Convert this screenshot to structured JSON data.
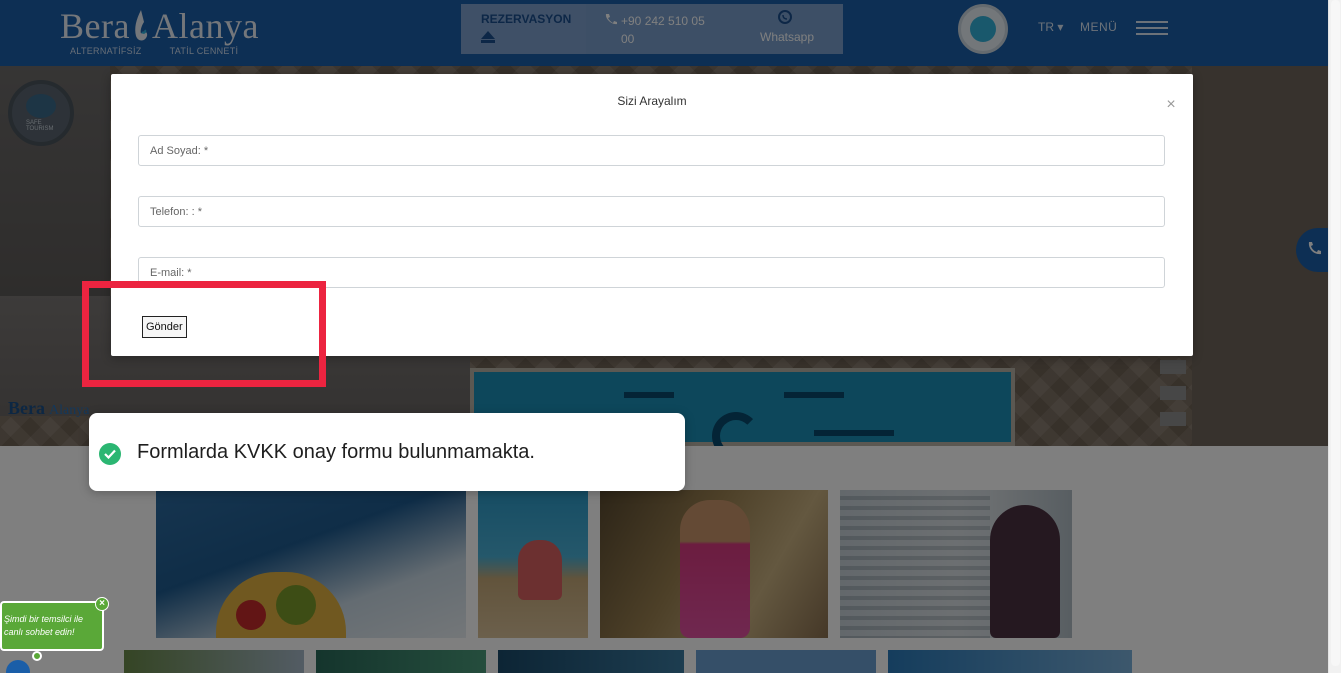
{
  "header": {
    "logo_word1": "Bera",
    "logo_word2": "Alanya",
    "logo_tag1": "ALTERNATİFSİZ",
    "logo_tag2": "TATİL CENNETİ",
    "reservation_label": "REZERVASYON",
    "phone_number": "+90 242 510 05 00",
    "whatsapp_label": "Whatsapp",
    "safe_badge_text": "SAFE TOURISM",
    "language": "TR",
    "menu_label": "MENÜ"
  },
  "hero": {
    "small_logo_word1": "Bera",
    "small_logo_word2": "Alanya",
    "safe_badge_text": "SAFE TOURISM"
  },
  "modal": {
    "title": "Sizi Arayalım",
    "close_symbol": "×",
    "fields": [
      {
        "placeholder": "Ad Soyad: *",
        "value": ""
      },
      {
        "placeholder": "Telefon: : *",
        "value": ""
      },
      {
        "placeholder": "E-mail: *",
        "value": ""
      }
    ],
    "submit_label": "Gönder"
  },
  "annotation": {
    "message": "Formlarda KVKK onay formu bulunmamakta."
  },
  "live_chat": {
    "message": "Şimdi bir temsilci ile canlı sohbet edin!",
    "close_symbol": "×"
  },
  "colors": {
    "header_bg": "#1a5ea8",
    "highlight": "#ec2440",
    "check": "#2bb672",
    "chat_green": "#5aa838"
  },
  "icons": [
    "phone-icon",
    "whatsapp-icon",
    "hamburger-icon",
    "close-icon",
    "check-icon",
    "phone-call-icon",
    "up-arrow-icon"
  ]
}
